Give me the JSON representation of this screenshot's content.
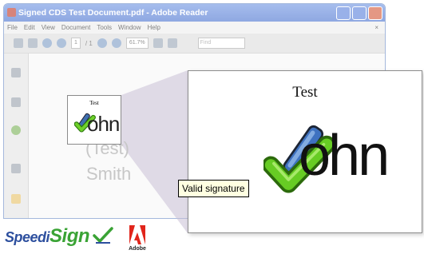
{
  "window": {
    "title": "Signed CDS Test Document.pdf - Adobe Reader",
    "menus": [
      "File",
      "Edit",
      "View",
      "Document",
      "Tools",
      "Window",
      "Help"
    ],
    "menu_close": "×"
  },
  "toolbar": {
    "page_current": "1",
    "page_total": "/ 1",
    "zoom": "61.7%",
    "find_placeholder": "Find"
  },
  "document": {
    "signature_field_title": "Test",
    "signature_name_partial": "ohn",
    "ghost_lines": [
      "(Test)",
      "Smith"
    ]
  },
  "zoom_view": {
    "title": "Test",
    "name_partial": "ohn"
  },
  "tooltip": "Valid signature",
  "logos": {
    "speedisign_part1": "Speedi",
    "speedisign_part2": "Sign",
    "adobe": "Adobe"
  },
  "colors": {
    "titlebar": "#5a82d8",
    "checkmark": "#5cbf1f",
    "speedi_blue": "#2d4f9e",
    "sign_green": "#3aa335",
    "adobe_red": "#e1251b"
  }
}
